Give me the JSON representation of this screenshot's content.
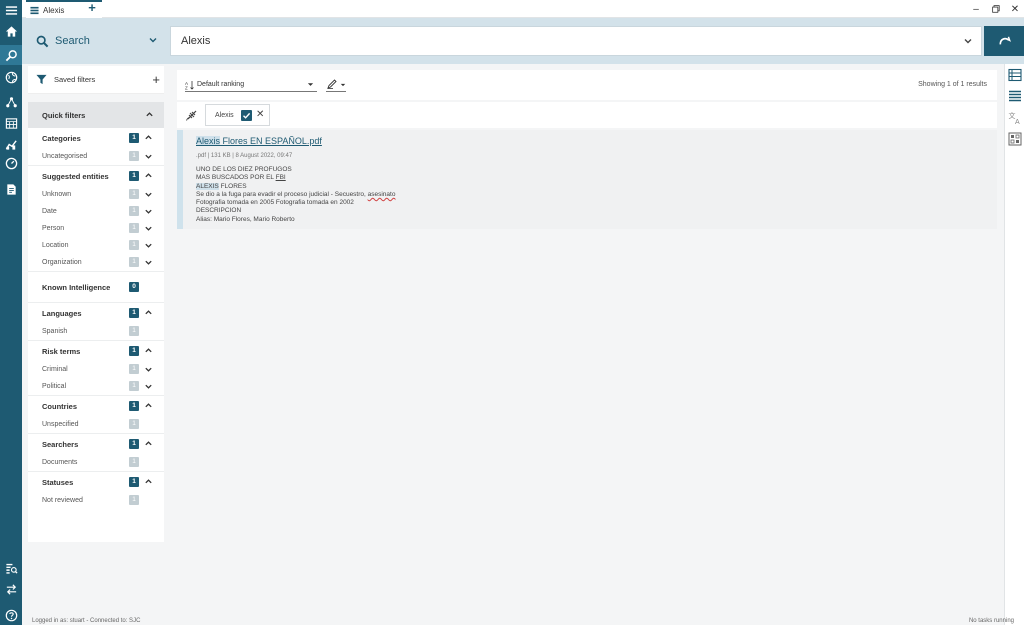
{
  "tab": {
    "title": "Alexis"
  },
  "search": {
    "mode_label": "Search",
    "query": "Alexis"
  },
  "filters": {
    "saved_label": "Saved filters",
    "quick_label": "Quick filters",
    "groups": [
      {
        "title": "Categories",
        "count": "1",
        "items": [
          {
            "label": "Uncategorised",
            "count": "1"
          }
        ]
      },
      {
        "title": "Suggested entities",
        "count": "1",
        "items": [
          {
            "label": "Unknown",
            "count": "1"
          },
          {
            "label": "Date",
            "count": "1"
          },
          {
            "label": "Person",
            "count": "1"
          },
          {
            "label": "Location",
            "count": "1"
          },
          {
            "label": "Organization",
            "count": "1"
          }
        ]
      },
      {
        "title": "Known Intelligence",
        "count": "0",
        "items": []
      },
      {
        "title": "Languages",
        "count": "1",
        "items": [
          {
            "label": "Spanish",
            "count": "1"
          }
        ]
      },
      {
        "title": "Risk terms",
        "count": "1",
        "items": [
          {
            "label": "Criminal",
            "count": "1"
          },
          {
            "label": "Political",
            "count": "1"
          }
        ]
      },
      {
        "title": "Countries",
        "count": "1",
        "items": [
          {
            "label": "Unspecified",
            "count": "1"
          }
        ]
      },
      {
        "title": "Searchers",
        "count": "1",
        "items": [
          {
            "label": "Documents",
            "count": "1"
          }
        ]
      },
      {
        "title": "Statuses",
        "count": "1",
        "items": [
          {
            "label": "Not reviewed",
            "count": "1"
          }
        ]
      }
    ]
  },
  "results": {
    "sort_label": "Default ranking",
    "showing": "Showing 1 of 1 results",
    "chip_label": "Alexis",
    "item": {
      "title_highlight": "Alexis",
      "title_rest": " Flores EN ESPAÑOL.pdf",
      "meta": ".pdf | 131 KB | 8 August 2022, 09:47",
      "line1": "UNO DE LOS DIEZ PROFUGOS",
      "line2_a": "MAS BUSCADOS POR EL ",
      "line2_b": "FBI",
      "line3_highlight": "ALEXIS",
      "line3_rest": " FLORES",
      "line4_a": "Se dio a la fuga para evadir el proceso judicial - Secuestro, ",
      "line4_b": "asesinato",
      "line5": "Fotografia tomada en 2005 Fotografia tomada en 2002",
      "line6": "DESCRIPCION",
      "line7": "Alias: Mario Flores, Mario Roberto"
    }
  },
  "status": {
    "left": "Logged in as: stuart - Connected to: SJC",
    "right": "No tasks running"
  },
  "icons": {
    "rail": [
      "menu-icon",
      "home-icon",
      "search-icon",
      "globe-icon",
      "graph-icon",
      "calendar-icon",
      "chart-icon",
      "compass-icon",
      "report-icon",
      "search-docs-icon",
      "transfer-icon",
      "help-icon"
    ],
    "right_rail": [
      "list-view-icon",
      "compact-list-icon",
      "translate-icon",
      "grid-view-icon"
    ]
  },
  "colors": {
    "accent": "#1e5a72",
    "header_bg": "#d3e2ea",
    "highlight": "#cfe0ea"
  }
}
